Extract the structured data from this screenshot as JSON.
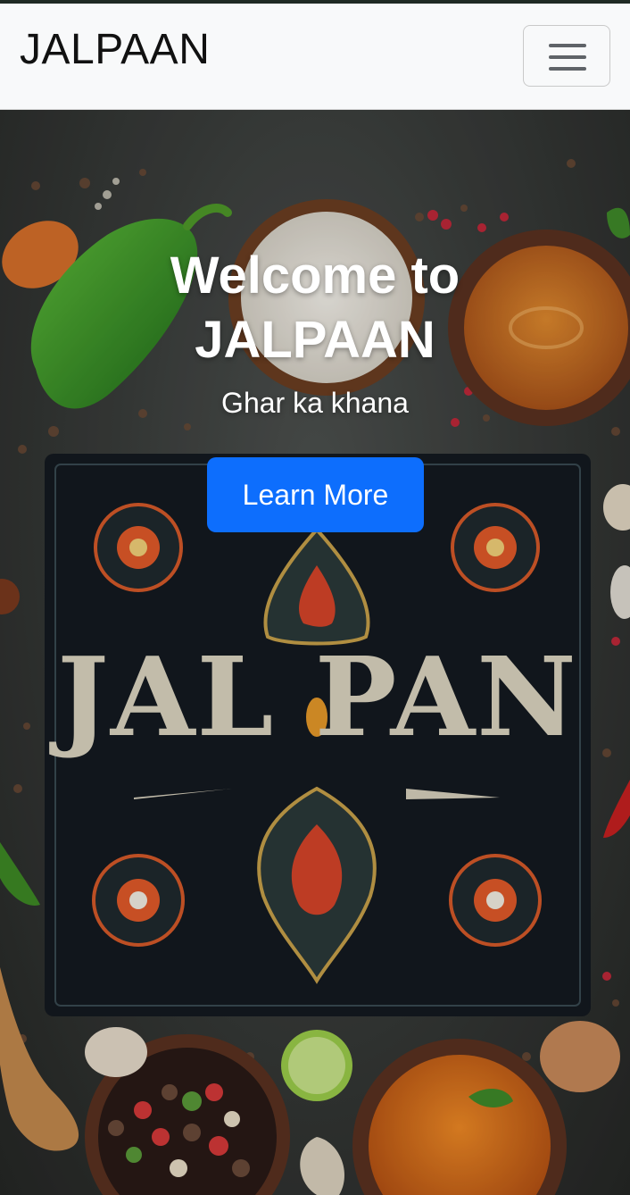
{
  "navbar": {
    "brand": "JALPAAN",
    "toggler_icon": "hamburger-menu-icon"
  },
  "hero": {
    "title": "Welcome to JALPAAN",
    "subtitle": "Ghar ka khana",
    "cta_label": "Learn More",
    "board_text": "JALPAN"
  },
  "colors": {
    "navbar_bg": "#f8f9fa",
    "button_bg": "#0d6efd",
    "text_light": "#ffffff"
  }
}
